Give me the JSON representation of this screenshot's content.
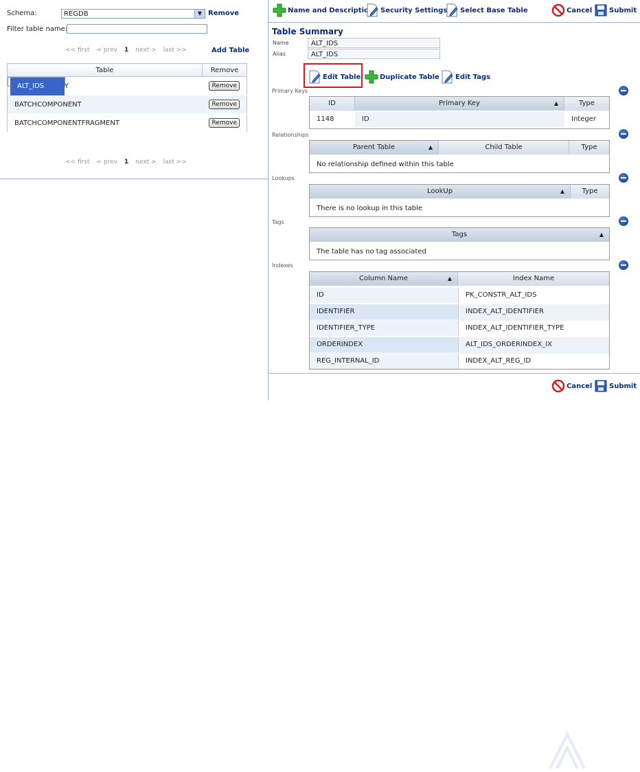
{
  "left": {
    "schema_label": "Schema:",
    "schema_value": "REGDB",
    "remove_label": "Remove",
    "filter_label": "Filter table name:",
    "filter_value": "",
    "pager": {
      "first": "<< first",
      "prev": "< prev",
      "page": "1",
      "next": "next >",
      "last": "last >>"
    },
    "add_table": "Add Table",
    "table": {
      "headers": [
        "Table",
        "Remove"
      ],
      "rows": [
        {
          "name": "ALT_IDS",
          "remove": ""
        },
        {
          "name": "AUDIT_HISTORY",
          "remove": "Remove"
        },
        {
          "name": "BATCHCOMPONENT",
          "remove": "Remove"
        },
        {
          "name": "BATCHCOMPONENTFRAGMENT",
          "remove": "Remove"
        }
      ]
    }
  },
  "toolbar": {
    "name_desc": "Name and Description",
    "security": "Security Settings",
    "base_table": "Select Base Table",
    "cancel": "Cancel",
    "submit": "Submit"
  },
  "summary": {
    "title": "Table Summary",
    "name_label": "Name",
    "name_value": "ALT_IDS",
    "alias_label": "Alias",
    "alias_value": "ALT_IDS",
    "edit_table": "Edit Table",
    "duplicate_table": "Duplicate Table",
    "edit_tags": "Edit Tags"
  },
  "primary_keys": {
    "label": "Primary Keys",
    "headers": [
      "ID",
      "Primary Key",
      "Type"
    ],
    "rows": [
      [
        "1148",
        "ID",
        "Integer"
      ]
    ]
  },
  "relationships": {
    "label": "Relationships",
    "headers": [
      "Parent Table",
      "Child Table",
      "Type"
    ],
    "empty": "No relationship defined within this table"
  },
  "lookups": {
    "label": "Lookups",
    "headers": [
      "LookUp",
      "Type"
    ],
    "empty": "There is no lookup in this table"
  },
  "tags": {
    "label": "Tags",
    "headers": [
      "Tags"
    ],
    "empty": "The table has no tag associated"
  },
  "indexes": {
    "label": "Indexes",
    "headers": [
      "Column Name",
      "Index Name"
    ],
    "rows": [
      [
        "ID",
        "PK_CONSTR_ALT_IDS"
      ],
      [
        "IDENTIFIER",
        "INDEX_ALT_IDENTIFIER"
      ],
      [
        "IDENTIFIER_TYPE",
        "INDEX_ALT_IDENTIFIER_TYPE"
      ],
      [
        "ORDERINDEX",
        "ALT_IDS_ORDERINDEX_IX"
      ],
      [
        "REG_INTERNAL_ID",
        "INDEX_ALT_REG_ID"
      ]
    ]
  },
  "bottom": {
    "cancel": "Cancel",
    "submit": "Submit"
  },
  "colors": {
    "accent": "#0b2e7a",
    "selected_row": "#3a64c8",
    "highlight": "#d41a1a"
  }
}
